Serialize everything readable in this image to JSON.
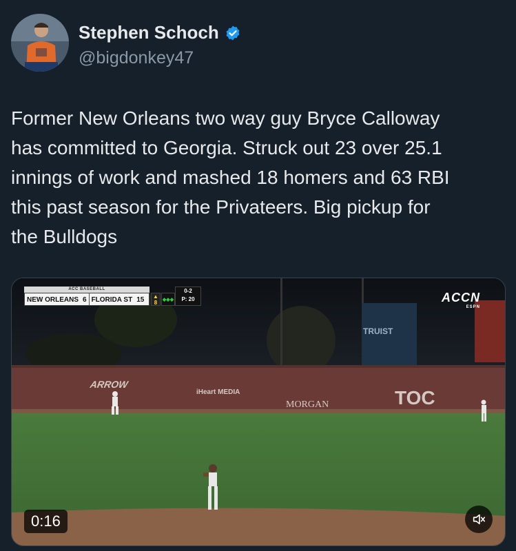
{
  "author": {
    "display_name": "Stephen Schoch",
    "handle": "@bigdonkey47",
    "verified": true
  },
  "tweet": {
    "lines": [
      "Former New Orleans two way guy Bryce Calloway",
      "has committed to Georgia. Struck out 23 over 25.1",
      "innings of work and mashed 18 homers and 63 RBI",
      "this past season for the Privateers. Big pickup for",
      "the Bulldogs"
    ]
  },
  "video": {
    "timestamp": "0:16",
    "scorebug": {
      "league": "ACC BASEBALL",
      "away_team": "NEW ORLEANS",
      "away_score": "6",
      "home_team": "FLORIDA ST",
      "home_score": "15",
      "inning_indicator": "8",
      "count": "0-2",
      "pitch_count": "P: 20"
    },
    "network": "ACCN",
    "network_sub": "ESPN",
    "signs": {
      "arrow": "ARROW",
      "iheart": "iHeart MEDIA",
      "morgan": "MORGAN",
      "toc": "TOC",
      "truist": "TRUIST"
    }
  },
  "colors": {
    "background": "#15202b",
    "verified": "#1d9bf0",
    "handle": "#8b98a5"
  }
}
